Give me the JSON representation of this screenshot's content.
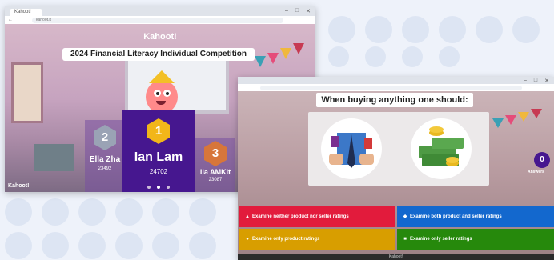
{
  "window1": {
    "tab_title": "Kahoot!",
    "url": "kahoot.it",
    "logo": "Kahoot!",
    "banner_title": "2024 Financial Literacy Individual Competition",
    "podium": [
      {
        "rank": "1",
        "name": "Ian Lam",
        "score": "24702"
      },
      {
        "rank": "2",
        "name": "Ella Zha",
        "score": "23492"
      },
      {
        "rank": "3",
        "name": "lla AMKit",
        "score": "23087"
      }
    ],
    "bottom_logo": "Kahoot!"
  },
  "window2": {
    "question": "When buying anything one should:",
    "answer_count": "0",
    "answer_count_label": "Answers",
    "answers": [
      {
        "symbol": "▲",
        "text": "Examine neither product nor seller ratings",
        "color": "#e21b3c"
      },
      {
        "symbol": "◆",
        "text": "Examine both product and seller ratings",
        "color": "#1368ce"
      },
      {
        "symbol": "●",
        "text": "Examine only product ratings",
        "color": "#d89e00"
      },
      {
        "symbol": "■",
        "text": "Examine only seller ratings",
        "color": "#26890c"
      }
    ],
    "footer": "Kahoot!"
  },
  "colors": {
    "kahoot_purple": "#46178f",
    "gold": "#f2b619",
    "red": "#e21b3c",
    "blue": "#1368ce",
    "yellow": "#d89e00",
    "green": "#26890c"
  }
}
